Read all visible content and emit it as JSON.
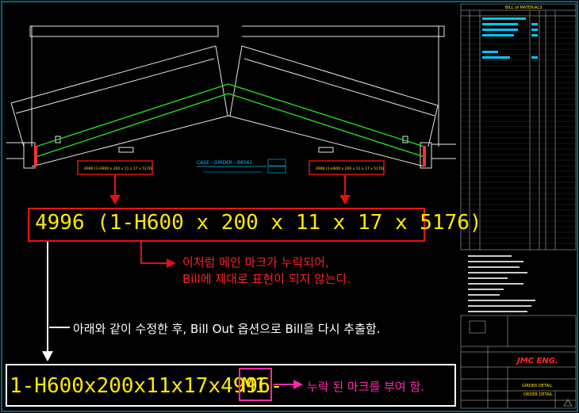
{
  "callout_top": {
    "text": "4996 (1-H600 x 200 x 11 x 17 x 5176)"
  },
  "note_red": {
    "line1": "이처럼 메인 마크가 누락되어,",
    "line2": "Bill에 제대로 표현이 되지 않는다."
  },
  "note_white": "아래와 같이 수정한 후, Bill Out 옵션으로 Bill을 다시 추출함.",
  "callout_bottom": {
    "text_main": "1-H600x200x11x17x4996-",
    "mark": "M1"
  },
  "note_magenta": "누락 된 마크를 부여 함.",
  "drawing": {
    "center_label": "CASE - GIRDER - B8561",
    "small_label_left": "4996 (1-H600 x 200 x 11 x 17 x 5176)",
    "small_label_right": "4996 (1-H600 x 200 x 11 x 17 x 5176)"
  },
  "title_block": {
    "bom_title": "BILL of MATERIALS",
    "logo": "JMC ENG.",
    "detail_title": "GIRDER DETAIL",
    "order": "ORDER DETAIL"
  },
  "colors": {
    "background": "#000000",
    "frame": "#00c8ff",
    "red_box": "#e11111",
    "yellow_text": "#ffe800",
    "green_line": "#22dd22",
    "magenta": "#ff2aa8"
  }
}
